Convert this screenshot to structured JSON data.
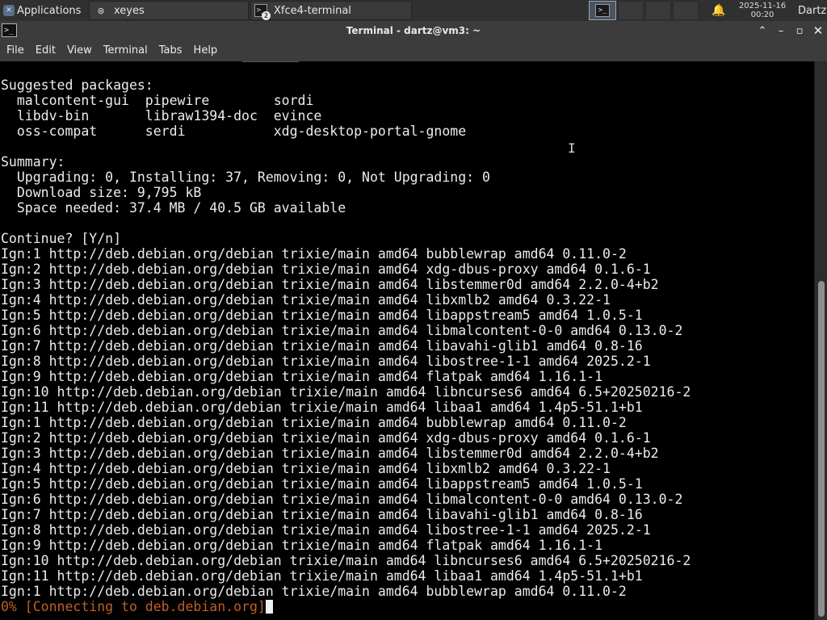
{
  "panel": {
    "applications_label": "Applications",
    "tasks": [
      {
        "label": "xeyes"
      },
      {
        "label": "Xfce4-terminal",
        "badge": "2"
      }
    ],
    "clock": {
      "date": "2025-11-16",
      "time": "00:20"
    },
    "user": "Dartz"
  },
  "window": {
    "title": "Terminal - dartz@vm3: ~"
  },
  "menubar": {
    "items": [
      "File",
      "Edit",
      "View",
      "Terminal",
      "Tabs",
      "Help"
    ]
  },
  "terminal": {
    "lines": [
      "Suggested packages:",
      "  malcontent-gui  pipewire        sordi",
      "  libdv-bin       libraw1394-doc  evince",
      "  oss-compat      serdi           xdg-desktop-portal-gnome",
      "",
      "Summary:",
      "  Upgrading: 0, Installing: 37, Removing: 0, Not Upgrading: 0",
      "  Download size: 9,795 kB",
      "  Space needed: 37.4 MB / 40.5 GB available",
      "",
      "Continue? [Y/n]",
      "Ign:1 http://deb.debian.org/debian trixie/main amd64 bubblewrap amd64 0.11.0-2",
      "Ign:2 http://deb.debian.org/debian trixie/main amd64 xdg-dbus-proxy amd64 0.1.6-1",
      "Ign:3 http://deb.debian.org/debian trixie/main amd64 libstemmer0d amd64 2.2.0-4+b2",
      "Ign:4 http://deb.debian.org/debian trixie/main amd64 libxmlb2 amd64 0.3.22-1",
      "Ign:5 http://deb.debian.org/debian trixie/main amd64 libappstream5 amd64 1.0.5-1",
      "Ign:6 http://deb.debian.org/debian trixie/main amd64 libmalcontent-0-0 amd64 0.13.0-2",
      "Ign:7 http://deb.debian.org/debian trixie/main amd64 libavahi-glib1 amd64 0.8-16",
      "Ign:8 http://deb.debian.org/debian trixie/main amd64 libostree-1-1 amd64 2025.2-1",
      "Ign:9 http://deb.debian.org/debian trixie/main amd64 flatpak amd64 1.16.1-1",
      "Ign:10 http://deb.debian.org/debian trixie/main amd64 libncurses6 amd64 6.5+20250216-2",
      "Ign:11 http://deb.debian.org/debian trixie/main amd64 libaa1 amd64 1.4p5-51.1+b1",
      "Ign:1 http://deb.debian.org/debian trixie/main amd64 bubblewrap amd64 0.11.0-2",
      "Ign:2 http://deb.debian.org/debian trixie/main amd64 xdg-dbus-proxy amd64 0.1.6-1",
      "Ign:3 http://deb.debian.org/debian trixie/main amd64 libstemmer0d amd64 2.2.0-4+b2",
      "Ign:4 http://deb.debian.org/debian trixie/main amd64 libxmlb2 amd64 0.3.22-1",
      "Ign:5 http://deb.debian.org/debian trixie/main amd64 libappstream5 amd64 1.0.5-1",
      "Ign:6 http://deb.debian.org/debian trixie/main amd64 libmalcontent-0-0 amd64 0.13.0-2",
      "Ign:7 http://deb.debian.org/debian trixie/main amd64 libavahi-glib1 amd64 0.8-16",
      "Ign:8 http://deb.debian.org/debian trixie/main amd64 libostree-1-1 amd64 2025.2-1",
      "Ign:9 http://deb.debian.org/debian trixie/main amd64 flatpak amd64 1.16.1-1",
      "Ign:10 http://deb.debian.org/debian trixie/main amd64 libncurses6 amd64 6.5+20250216-2",
      "Ign:11 http://deb.debian.org/debian trixie/main amd64 libaa1 amd64 1.4p5-51.1+b1",
      "Ign:1 http://deb.debian.org/debian trixie/main amd64 bubblewrap amd64 0.11.0-2"
    ],
    "status_line": "0% [Connecting to deb.debian.org]"
  },
  "colors": {
    "panel_bg": "#303030",
    "titlebar_bg": "#3c3c3c",
    "terminal_bg": "#000000",
    "terminal_fg": "#ececec",
    "status_fg": "#c05f22",
    "scrollbar_thumb": "#8f8f8f"
  },
  "icons": {
    "applications": "xfce-logo-icon",
    "xeyes_task": "xeyes-icon",
    "terminal_task": "terminal-icon",
    "notifications": "bell-icon",
    "window_menu": "terminal-icon",
    "window_controls": [
      "chevron-up-icon",
      "minimize-icon",
      "maximize-icon",
      "close-icon"
    ]
  }
}
